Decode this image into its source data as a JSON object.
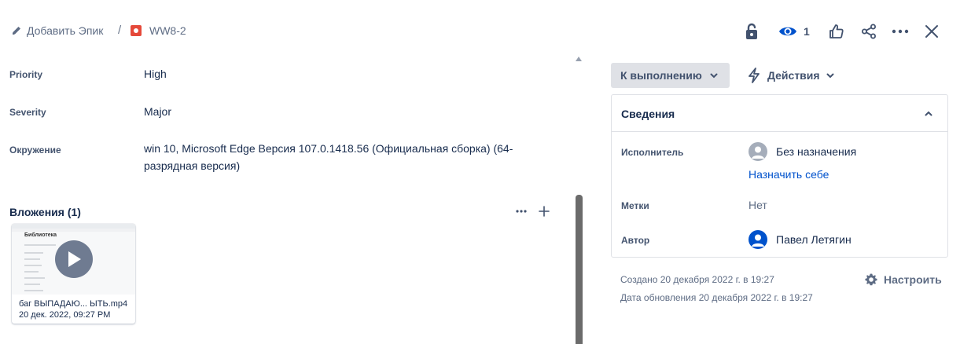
{
  "breadcrumb": {
    "add_epic": "Добавить Эпик",
    "separator": "/",
    "issue_key": "WW8-2",
    "issue_type_icon": "bug-icon"
  },
  "toolbar": {
    "lock_icon": "unlock-icon",
    "watch_icon": "eye-icon",
    "watch_count": "1",
    "vote_icon": "thumbs-up-icon",
    "share_icon": "share-icon",
    "more_icon": "more-icon",
    "close_icon": "close-icon"
  },
  "fields": [
    {
      "label": "Priority",
      "value": "High"
    },
    {
      "label": "Severity",
      "value": "Major"
    },
    {
      "label": "Окружение",
      "value": "win 10, Microsoft Edge Версия 107.0.1418.56 (Официальная сборка) (64-разрядная версия)"
    }
  ],
  "attachments": {
    "title": "Вложения (1)",
    "items": [
      {
        "name": "баг ВЫПАДАЮ... ЫТЬ.mp4",
        "date": "20 дек. 2022, 09:27 PM",
        "thumb_heading": "Библиотека"
      }
    ]
  },
  "status": {
    "label": "К выполнению",
    "actions_label": "Действия"
  },
  "details": {
    "title": "Сведения",
    "assignee_label": "Исполнитель",
    "assignee_value": "Без назначения",
    "assign_self": "Назначить себе",
    "labels_label": "Метки",
    "labels_value": "Нет",
    "reporter_label": "Автор",
    "reporter_value": "Павел Летягин"
  },
  "meta": {
    "created": "Создано 20 декабря 2022 г. в 19:27",
    "updated": "Дата обновления 20 декабря 2022 г. в 19:27",
    "configure": "Настроить"
  },
  "colors": {
    "link": "#0052cc",
    "bug": "#e5493a",
    "button_bg": "#dfe1e6"
  }
}
